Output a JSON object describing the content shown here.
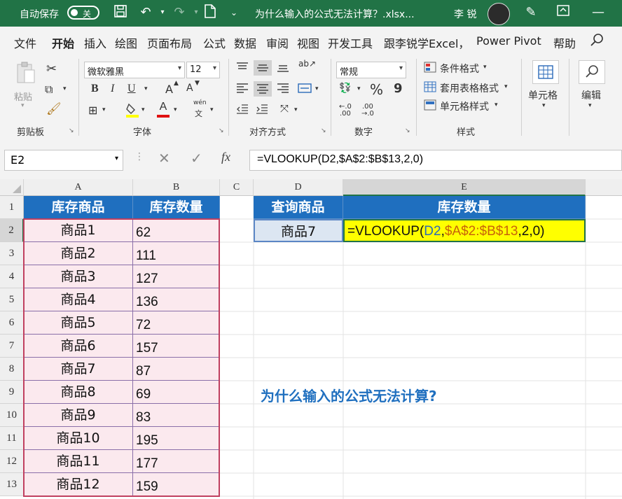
{
  "titlebar": {
    "autosave_label": "自动保存",
    "autosave_state": "关",
    "doc_title": "为什么输入的公式无法计算？.xlsx...",
    "user_name": "李 锐"
  },
  "tabs": [
    "文件",
    "开始",
    "插入",
    "绘图",
    "页面布局",
    "公式",
    "数据",
    "审阅",
    "视图",
    "开发工具",
    "跟李锐学Excel，",
    "Power Pivot",
    "帮助"
  ],
  "active_tab": "开始",
  "ribbon": {
    "paste_label": "粘贴",
    "clipboard_group": "剪贴板",
    "font_name": "微软雅黑",
    "font_size": "12",
    "font_group": "字体",
    "bold": "B",
    "italic": "I",
    "underline": "U",
    "grow_font": "A",
    "shrink_font": "A",
    "phonetic_label": "wén",
    "phonetic_char": "文",
    "align_group": "对齐方式",
    "number_format": "常规",
    "number_group": "数字",
    "percent": "%",
    "comma": "9",
    "cond_format": "条件格式",
    "table_format": "套用表格格式",
    "cell_style": "单元格样式",
    "styles_group": "样式",
    "cells_label": "单元格",
    "edit_label": "编辑"
  },
  "formula_bar": {
    "name_box": "E2",
    "fx": "fx",
    "formula": "=VLOOKUP(D2,$A$2:$B$13,2,0)"
  },
  "sheet": {
    "columns": [
      "A",
      "B",
      "C",
      "D",
      "E"
    ],
    "rows": [
      "1",
      "2",
      "3",
      "4",
      "5",
      "6",
      "7",
      "8",
      "9",
      "10",
      "11",
      "12",
      "13"
    ],
    "header_a": "库存商品",
    "header_b": "库存数量",
    "items": [
      {
        "name": "商品1",
        "qty": "62"
      },
      {
        "name": "商品2",
        "qty": "111"
      },
      {
        "name": "商品3",
        "qty": "127"
      },
      {
        "name": "商品4",
        "qty": "136"
      },
      {
        "name": "商品5",
        "qty": "72"
      },
      {
        "name": "商品6",
        "qty": "157"
      },
      {
        "name": "商品7",
        "qty": "87"
      },
      {
        "name": "商品8",
        "qty": "69"
      },
      {
        "name": "商品9",
        "qty": "83"
      },
      {
        "name": "商品10",
        "qty": "195"
      },
      {
        "name": "商品11",
        "qty": "177"
      },
      {
        "name": "商品12",
        "qty": "159"
      }
    ],
    "header_d": "查询商品",
    "header_e": "库存数量",
    "d2": "商品7",
    "e2_parts": {
      "p1": "=VLOOKUP(",
      "p2": "D2",
      "p3": ",",
      "p4": "$A$2:$B$13",
      "p5": ",2,0)"
    },
    "note": "为什么输入的公式无法计算?"
  },
  "colors": {
    "excel_green": "#217346",
    "header_blue": "#1f6fbf",
    "highlight_yellow": "#ffff00",
    "range_pink": "#fbe9ee",
    "ref_orange": "#c8620a"
  }
}
